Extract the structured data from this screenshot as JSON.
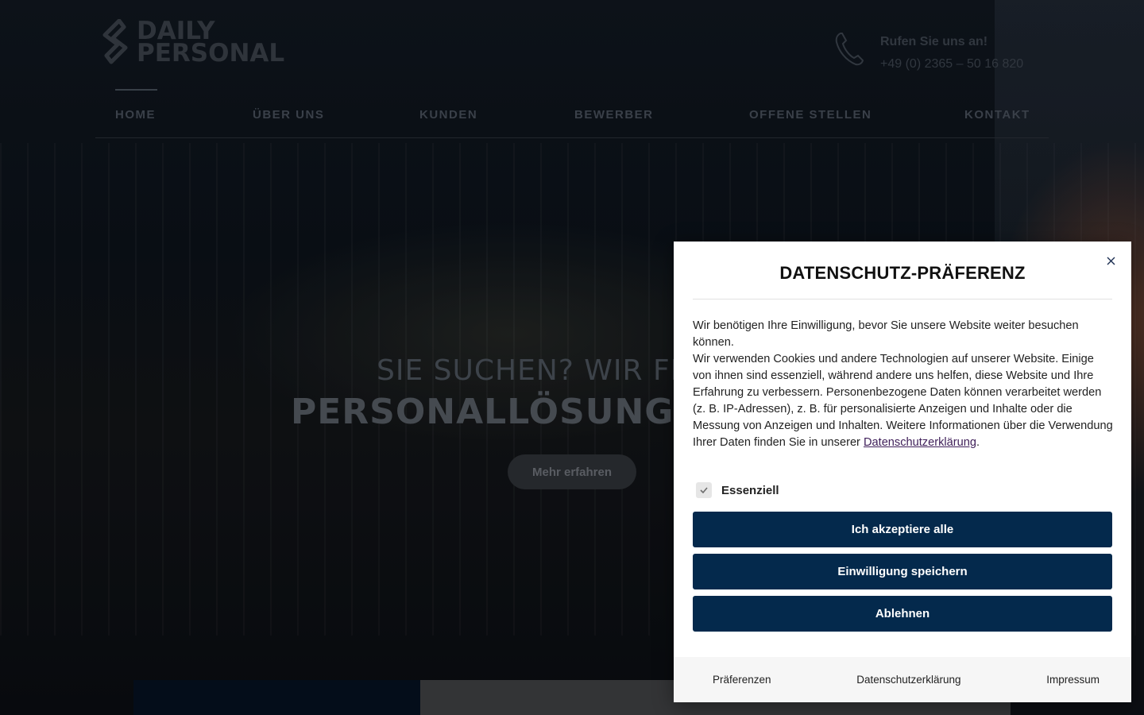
{
  "header": {
    "logo_line1": "DAILY",
    "logo_line2": "PERSONAL",
    "phone_title": "Rufen Sie uns an!",
    "phone_number": "+49 (0) 2365 – 50 16 820",
    "phone_icon": "phone-icon"
  },
  "nav": {
    "items": [
      {
        "label": "HOME"
      },
      {
        "label": "ÜBER UNS"
      },
      {
        "label": "KUNDEN"
      },
      {
        "label": "BEWERBER"
      },
      {
        "label": "OFFENE STELLEN"
      },
      {
        "label": "KONTAKT"
      }
    ],
    "active": "HOME"
  },
  "hero": {
    "line1": "SIE SUCHEN? WIR FI",
    "line2": "PERSONALLÖSUNGEI",
    "button": "Mehr erfahren"
  },
  "consent": {
    "title": "DATENSCHUTZ-PRÄFERENZ",
    "close_icon": "close-icon",
    "para1": "Wir benötigen Ihre Einwilligung, bevor Sie unsere Website weiter besuchen können.",
    "para2": "Wir verwenden Cookies und andere Technologien auf unserer Website. Einige von ihnen sind essenziell, während andere uns helfen, diese Website und Ihre Erfahrung zu verbessern. Personenbezogene Daten können verarbeitet werden (z. B. IP-Adressen), z. B. für personalisierte Anzeigen und Inhalte oder die Messung von Anzeigen und Inhalten. Weitere Informationen über die Verwendung Ihrer Daten finden Sie in unserer",
    "privacy_link": "Datenschutzerklärung",
    "period": ".",
    "checkbox_label": "Essenziell",
    "checkbox_checked": true,
    "accept_all": "Ich akzeptiere alle",
    "save_consent": "Einwilligung speichern",
    "deny": "Ablehnen",
    "footer": {
      "preferences": "Präferenzen",
      "privacy": "Datenschutzerklärung",
      "imprint": "Impressum"
    }
  },
  "colors": {
    "primary_button": "#04294c",
    "link": "#40205a"
  }
}
